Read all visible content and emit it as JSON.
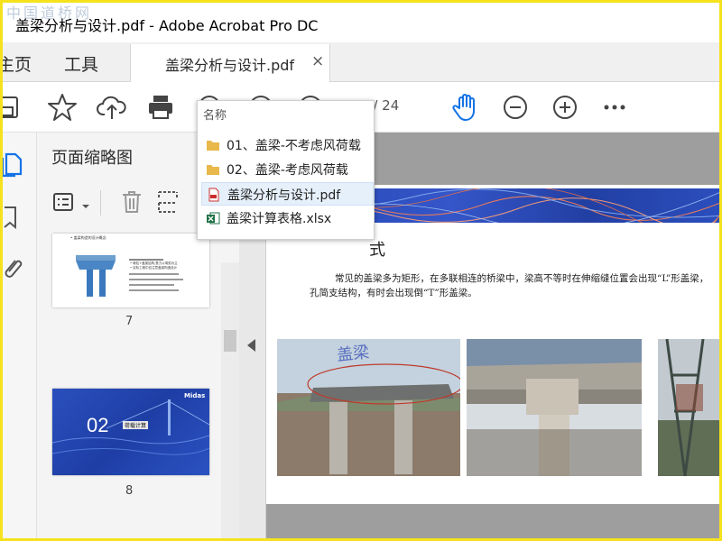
{
  "window": {
    "watermark": "中国道桥网",
    "title": "盖梁分析与设计.pdf - Adobe Acrobat Pro DC"
  },
  "tabs": {
    "home_label": "主页",
    "tools_label": "工具",
    "document_label": "盖梁分析与设计.pdf",
    "close_glyph": "×"
  },
  "toolbar": {
    "icons": [
      "save-icon",
      "star-icon",
      "upload-icon",
      "print-icon",
      "zoom-icon",
      "up-icon",
      "down-icon",
      "hand-icon",
      "zoom-out-icon",
      "zoom-in-icon",
      "more-icon"
    ],
    "page_current": "1",
    "page_total": "/ 24",
    "accent_color": "#1473e6"
  },
  "thumbnails_panel": {
    "title": "页面缩略图",
    "pages": [
      {
        "number": "7",
        "heading": "• 盖梁构造的设计概念",
        "body": "• 墩柱+盖梁结构,受力以弯剪为主\n• 实际工程中应注意盖梁构造设计"
      },
      {
        "number": "8",
        "section_number": "02",
        "section_text": "荷载计算",
        "logo": "Midas"
      }
    ]
  },
  "file_popup": {
    "header": "名称",
    "items": [
      {
        "label": "01、盖梁-不考虑风荷载",
        "type": "folder"
      },
      {
        "label": "02、盖梁-考虑风荷载",
        "type": "folder"
      },
      {
        "label": "盖梁分析与设计.pdf",
        "type": "pdf",
        "selected": true
      },
      {
        "label": "盖梁计算表格.xlsx",
        "type": "xlsx"
      }
    ]
  },
  "document": {
    "heading_fragment": "式",
    "paragraph_line1": "常见的盖梁多为矩形，在多联相连的桥梁中，梁高不等时在伸缩缝位置会出现“L”形盖梁，",
    "paragraph_line2": "孔简支结构，有时会出现倒“T”形盖梁。",
    "photo1_annotation": "盖梁"
  }
}
